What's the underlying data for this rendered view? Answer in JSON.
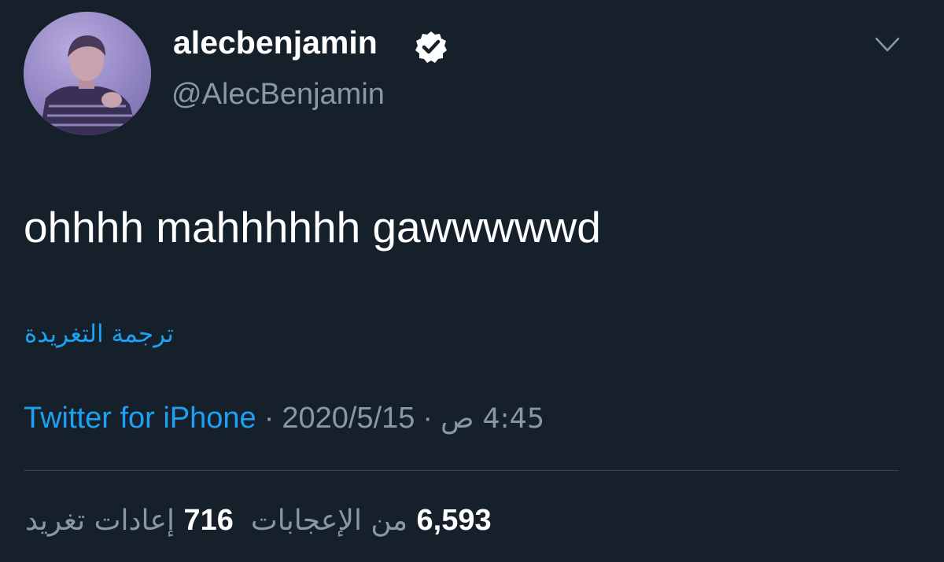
{
  "tweet": {
    "display_name": "alecbenjamin",
    "handle": "@AlecBenjamin",
    "verified": true,
    "text": "ohhhh mahhhhhh gawwwwwd",
    "translate_label": "ترجمة التغريدة",
    "source": "Twitter for iPhone",
    "separator": "·",
    "date": "2020/5/15",
    "time": "4:45 ص",
    "likes_count": "6,593",
    "likes_label": "من الإعجابات",
    "retweets_count": "716",
    "retweets_label": "إعادات تغريد"
  },
  "colors": {
    "background": "#15202b",
    "text": "#ffffff",
    "secondary": "#8899a6",
    "accent": "#1da1f2",
    "divider": "#38444d"
  },
  "icons": {
    "verified": "verified-badge-icon",
    "menu": "chevron-down-icon"
  }
}
